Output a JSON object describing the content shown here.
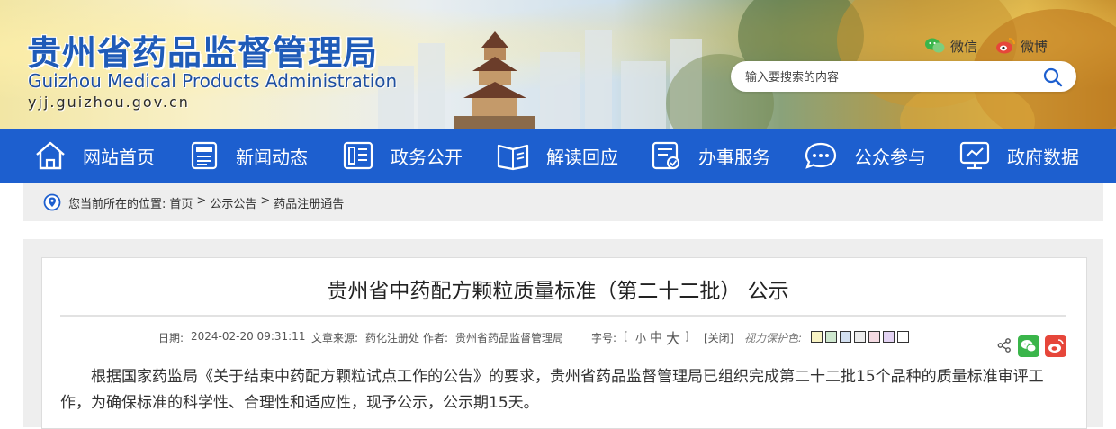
{
  "header": {
    "title_cn": "贵州省药品监督管理局",
    "title_en": "Guizhou Medical Products Administration",
    "url": "yjj.guizhou.gov.cn",
    "social": {
      "wechat_label": "微信",
      "weibo_label": "微博"
    },
    "search": {
      "placeholder": "输入要搜索的内容"
    }
  },
  "nav": {
    "items": [
      {
        "label": "网站首页",
        "icon": "home-icon"
      },
      {
        "label": "新闻动态",
        "icon": "news-icon"
      },
      {
        "label": "政务公开",
        "icon": "document-icon"
      },
      {
        "label": "解读回应",
        "icon": "book-icon"
      },
      {
        "label": "办事服务",
        "icon": "service-icon"
      },
      {
        "label": "公众参与",
        "icon": "chat-icon"
      },
      {
        "label": "政府数据",
        "icon": "data-monitor-icon"
      }
    ]
  },
  "breadcrumb": {
    "prefix": "您当前所在的位置:",
    "items": [
      "首页",
      "公示公告",
      "药品注册通告"
    ],
    "separator": ">"
  },
  "article": {
    "title": "贵州省中药配方颗粒质量标准（第二十二批） 公示",
    "meta": {
      "date_label": "日期:",
      "date": "2024-02-20 09:31:11",
      "source_label": "文章来源:",
      "source": "药化注册处",
      "author_label": "作者:",
      "author": "贵州省药品监督管理局",
      "font_label": "字号:",
      "bracket_open": "[",
      "bracket_close": "]",
      "font_small": "小",
      "font_medium": "中",
      "font_large": "大",
      "close_label": "[关闭]",
      "eye_label": "视力保护色:"
    },
    "eye_colors": [
      "#f9f4c4",
      "#cfe8cf",
      "#d3e0f0",
      "#ececec",
      "#f5dbe3",
      "#e3d3f3",
      "#ffffff"
    ],
    "body": "根据国家药监局《关于结束中药配方颗粒试点工作的公告》的要求，贵州省药品监督管理局已组织完成第二十二批15个品种的质量标准审评工作，为确保标准的科学性、合理性和适应性，现予公示，公示期15天。"
  },
  "colors": {
    "nav_bg": "#1d5fcf",
    "title_blue": "#1f5bb8",
    "accent_red": "#cc0000",
    "wechat_green": "#3ab54a",
    "weibo_red": "#e6463a"
  }
}
